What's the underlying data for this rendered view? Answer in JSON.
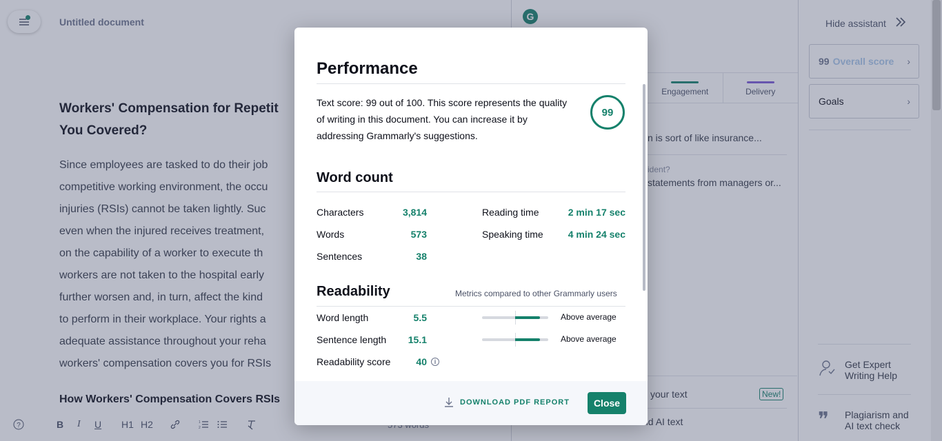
{
  "editor": {
    "doc_title": "Untitled document",
    "heading": "Workers' Compensation for Repetit... You Covered?",
    "heading_line1": "Workers' Compensation for Repetit",
    "heading_line2": "You Covered?",
    "body_lines": [
      "Since employees are tasked to do their job",
      "competitive working environment, the occu",
      "injuries (RSIs) cannot be taken lightly. Suc",
      "even when the injured receives treatment,",
      "on the capability of a worker to execute th",
      "workers are not taken to the hospital early",
      "further worsen and, in turn, affect the kind",
      "to perform in their workplace. Your rights a",
      "adequate assistance throughout your reha",
      "workers' compensation covers you for RSIs"
    ],
    "subheading": "How Workers' Compensation Covers RSIs",
    "word_count": "573 words",
    "toolbar": [
      "B",
      "I",
      "U",
      "H1",
      "H2",
      "link",
      "ordered-list",
      "bullet-list",
      "clear-format"
    ]
  },
  "assistant": {
    "logo": "G",
    "tabs": [
      {
        "label": "Engagement",
        "color": "#15816b"
      },
      {
        "label": "Delivery",
        "color": "#7b5ad6"
      }
    ],
    "text1": "n is sort of like insurance...",
    "text2": "ident?",
    "text3": "statements from managers or...",
    "bottom1": "your text",
    "bottom_badge": "New!",
    "bottom2": "nd AI text"
  },
  "right_panel": {
    "hide_label": "Hide assistant",
    "overall_score_num": "99",
    "overall_score_label": "Overall score",
    "goals_label": "Goals",
    "expert_label": "Get Expert Writing Help",
    "expert_line1": "Get Expert",
    "expert_line2": "Writing Help",
    "plag_line1": "Plagiarism and",
    "plag_line2": "AI text check"
  },
  "modal": {
    "performance_title": "Performance",
    "performance_text": "Text score: 99 out of 100. This score represents the quality of writing in this document. You can increase it by addressing Grammarly's suggestions.",
    "score": "99",
    "word_count_title": "Word count",
    "stats_left": [
      {
        "label": "Characters",
        "value": "3,814"
      },
      {
        "label": "Words",
        "value": "573"
      },
      {
        "label": "Sentences",
        "value": "38"
      }
    ],
    "stats_right": [
      {
        "label": "Reading time",
        "value": "2 min 17 sec"
      },
      {
        "label": "Speaking time",
        "value": "4 min 24 sec"
      }
    ],
    "readability_title": "Readability",
    "readability_note": "Metrics compared to other Grammarly users",
    "readability": [
      {
        "label": "Word length",
        "value": "5.5",
        "compare": "Above average",
        "meter_fraction": 0.38
      },
      {
        "label": "Sentence length",
        "value": "15.1",
        "compare": "Above average",
        "meter_fraction": 0.38
      },
      {
        "label": "Readability score",
        "value": "40"
      }
    ],
    "download_label": "DOWNLOAD PDF REPORT",
    "close_label": "Close"
  },
  "colors": {
    "accent": "#15816b",
    "overlay": "rgba(70,80,110,0.38)",
    "delivery": "#7b5ad6"
  }
}
